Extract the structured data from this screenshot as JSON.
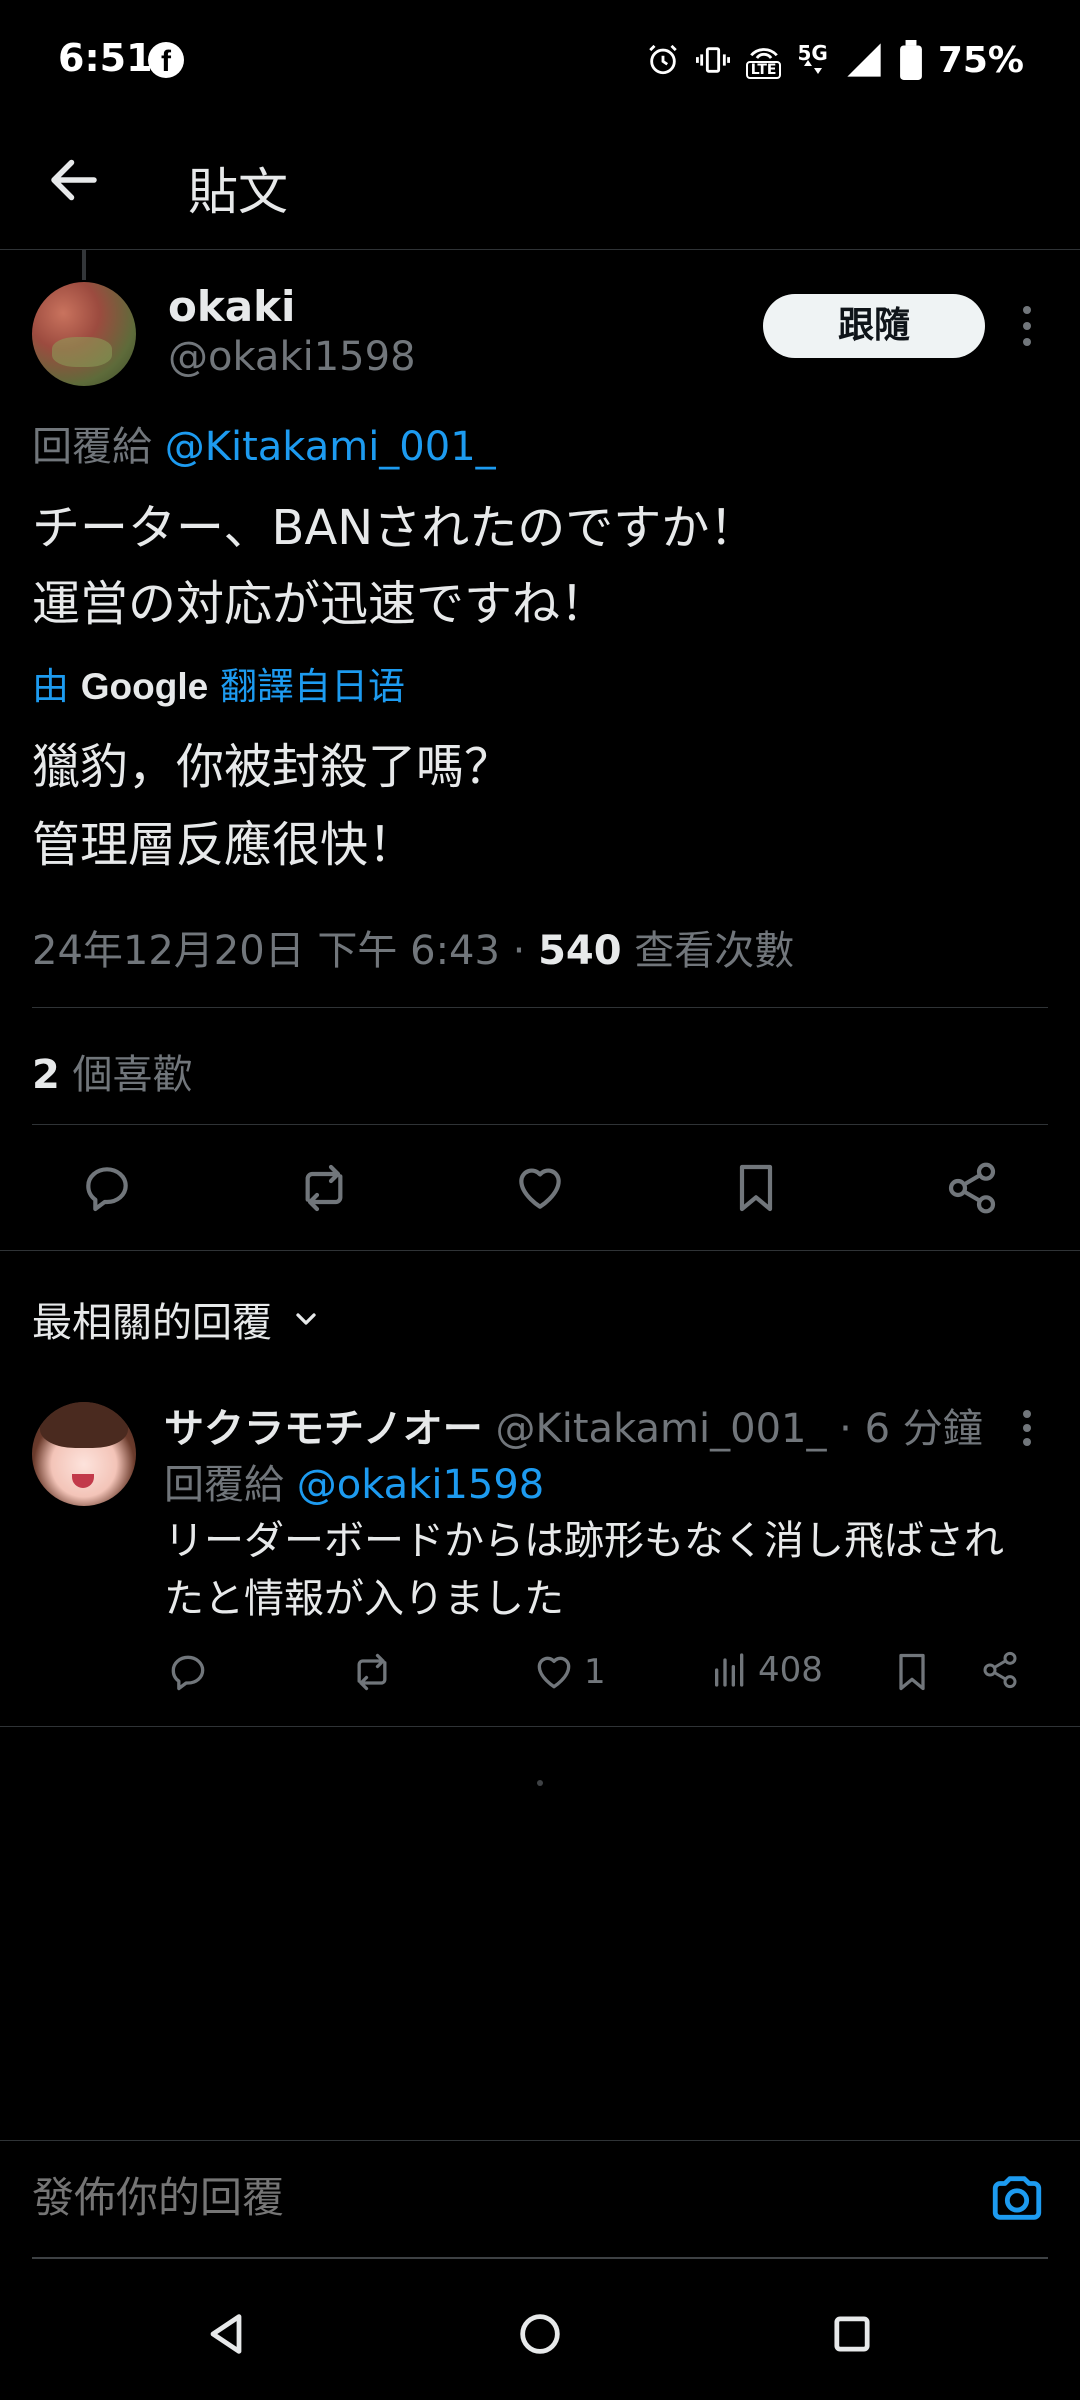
{
  "status_bar": {
    "time": "6:51",
    "lte_label": "LTE",
    "network": "5G",
    "battery": "75%",
    "icons": [
      "facebook-icon",
      "alarm-icon",
      "vibrate-icon",
      "volte-icon",
      "signal-icon",
      "battery-icon"
    ]
  },
  "app_bar": {
    "title": "貼文"
  },
  "post": {
    "author_name": "okaki",
    "author_handle": "@okaki1598",
    "follow_label": "跟隨",
    "reply_to_prefix": "回覆給 ",
    "reply_to_handle": "@Kitakami_001_",
    "text_lines": [
      "チーター、BANされたのですか！",
      "運営の対応が迅速ですね！"
    ],
    "translate_prefix": "由 ",
    "translate_brand": "Google",
    "translate_suffix": " 翻譯自日语",
    "translated_lines": [
      "獵豹，你被封殺了嗎？",
      "管理層反應很快！"
    ],
    "timestamp": "24年12月20日 下午 6:43 · ",
    "views_count": "540",
    "views_label": " 查看次數",
    "likes_count": "2",
    "likes_label": " 個喜歡"
  },
  "sort": {
    "label": "最相關的回覆"
  },
  "reply": {
    "author_name": "サクラモチノオー",
    "author_handle": " @Kitakami_001_ · 6 分鐘",
    "reply_to_prefix": "回覆給 ",
    "reply_to_handle": "@okaki1598",
    "text_lines": [
      "リーダーボードからは跡形もなく消し飛ばされ",
      "たと情報が入りました"
    ],
    "likes": "1",
    "views": "408"
  },
  "compose": {
    "placeholder": "發佈你的回覆"
  },
  "colors": {
    "background": "#000000",
    "accent": "#1d9bf0",
    "secondary_text": "#71767b",
    "primary_text": "#e7e9ea",
    "divider": "#2f3336"
  }
}
